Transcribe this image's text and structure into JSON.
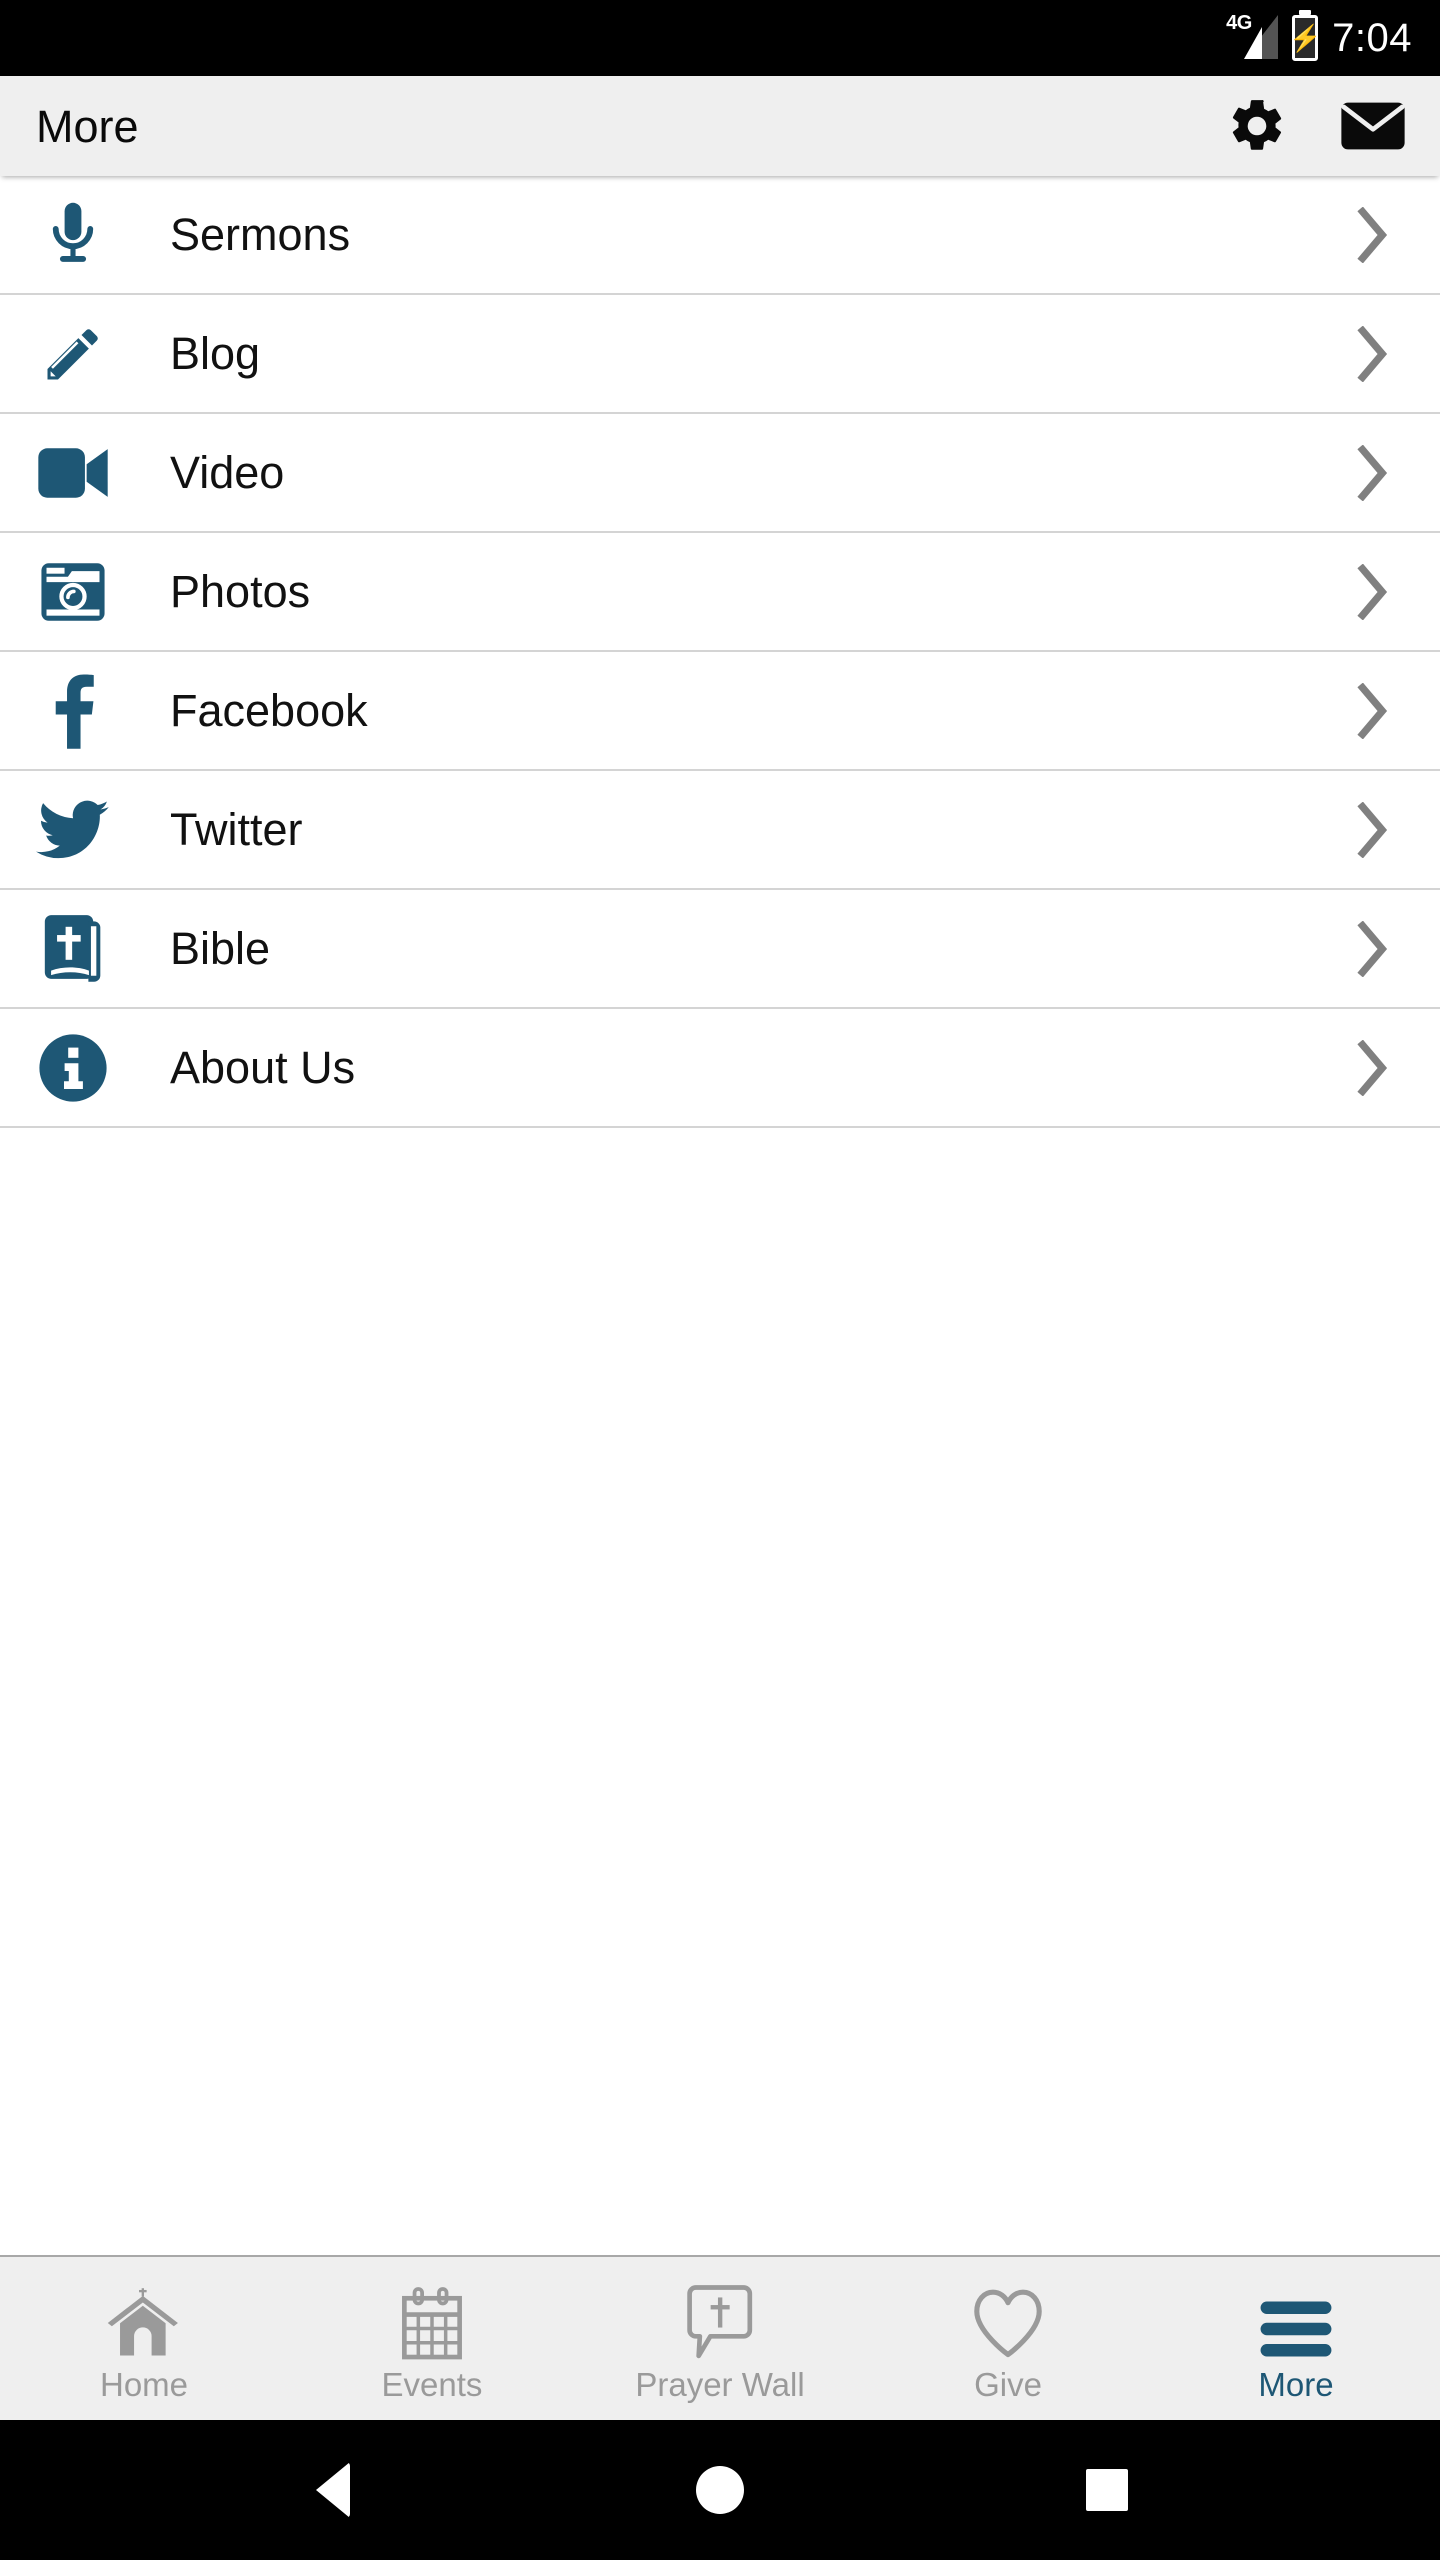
{
  "status_bar": {
    "network": "4G",
    "battery_state": "charging",
    "time": "7:04"
  },
  "header": {
    "title": "More",
    "actions": [
      {
        "name": "settings",
        "icon": "gear-icon"
      },
      {
        "name": "messages",
        "icon": "envelope-icon"
      }
    ]
  },
  "menu": {
    "items": [
      {
        "label": "Sermons",
        "icon": "microphone-icon",
        "chevron": "chevron-right-icon"
      },
      {
        "label": "Blog",
        "icon": "pencil-icon",
        "chevron": "chevron-right-icon"
      },
      {
        "label": "Video",
        "icon": "videocam-icon",
        "chevron": "chevron-right-icon"
      },
      {
        "label": "Photos",
        "icon": "camera-icon",
        "chevron": "chevron-right-icon"
      },
      {
        "label": "Facebook",
        "icon": "facebook-icon",
        "chevron": "chevron-right-icon"
      },
      {
        "label": "Twitter",
        "icon": "twitter-icon",
        "chevron": "chevron-right-icon"
      },
      {
        "label": "Bible",
        "icon": "bible-book-icon",
        "chevron": "chevron-right-icon"
      },
      {
        "label": "About Us",
        "icon": "info-circle-icon",
        "chevron": "chevron-right-icon"
      }
    ]
  },
  "tabbar": {
    "tabs": [
      {
        "label": "Home",
        "icon": "church-icon",
        "active": false
      },
      {
        "label": "Events",
        "icon": "calendar-icon",
        "active": false
      },
      {
        "label": "Prayer Wall",
        "icon": "prayer-bubble-icon",
        "active": false
      },
      {
        "label": "Give",
        "icon": "heart-icon",
        "active": false
      },
      {
        "label": "More",
        "icon": "hamburger-icon",
        "active": true
      }
    ]
  },
  "system_nav": {
    "back": "back-triangle-icon",
    "home": "home-circle-icon",
    "recents": "recents-square-icon"
  },
  "colors": {
    "accent": "#1e5775",
    "header_bg": "#efefef",
    "list_bg": "#ffffff",
    "divider": "#d4d4d4",
    "chevron": "#808080",
    "tab_inactive": "#9a9a9a",
    "status_bg": "#000000"
  }
}
